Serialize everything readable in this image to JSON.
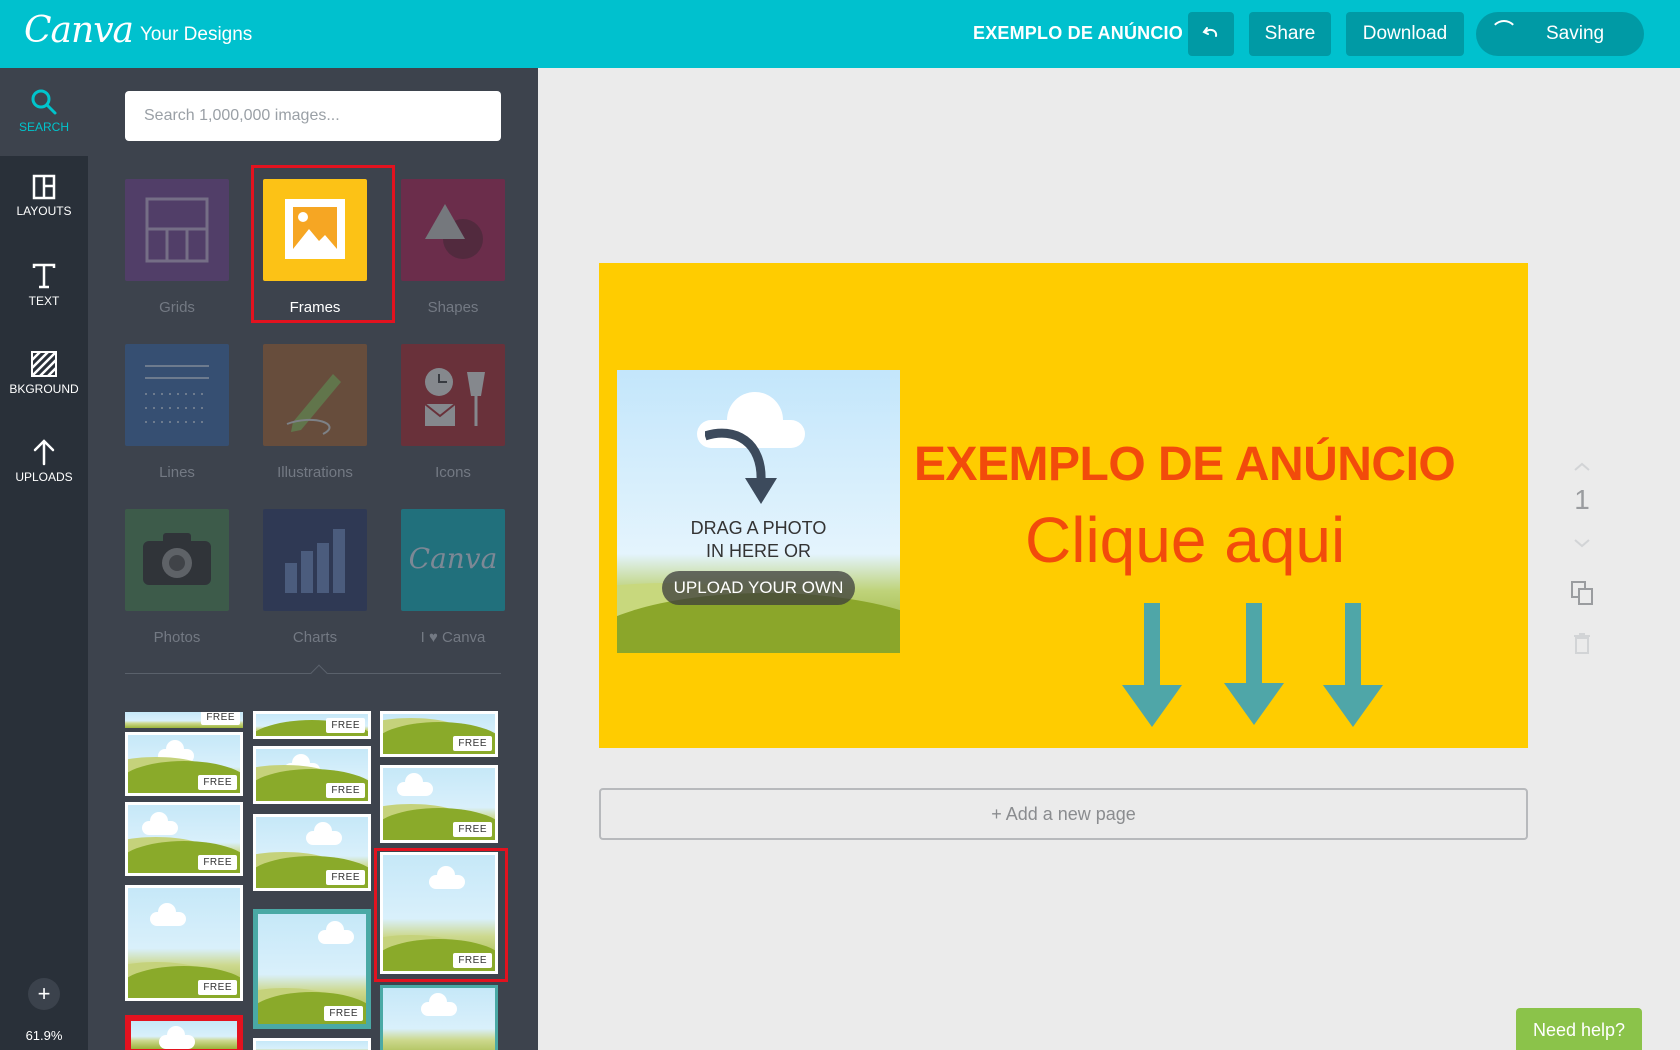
{
  "app": {
    "logo_text": "Canva"
  },
  "header": {
    "your_designs": "Your Designs",
    "doc_title": "EXEMPLO DE ANÚNCIO",
    "share_label": "Share",
    "download_label": "Download",
    "saving_label": "Saving"
  },
  "rail": {
    "items": [
      {
        "label": "SEARCH",
        "icon": "search-icon"
      },
      {
        "label": "LAYOUTS",
        "icon": "layouts-icon"
      },
      {
        "label": "TEXT",
        "icon": "text-icon"
      },
      {
        "label": "BKGROUND",
        "icon": "background-icon"
      },
      {
        "label": "UPLOADS",
        "icon": "upload-icon"
      }
    ],
    "zoom_in": "+",
    "zoom_level": "61.9%",
    "zoom_out": "–"
  },
  "panel": {
    "search_placeholder": "Search 1,000,000 images...",
    "categories": [
      "Grids",
      "Frames",
      "Shapes",
      "Lines",
      "Illustrations",
      "Icons",
      "Photos",
      "Charts",
      "I ♥ Canva"
    ],
    "badge": "FREE"
  },
  "design": {
    "drag_line1": "DRAG A PHOTO",
    "drag_line2": "IN HERE OR",
    "upload_label": "UPLOAD YOUR OWN",
    "headline": "EXEMPLO DE ANÚNCIO",
    "subline": "Clique aqui",
    "bg_color": "#ffcc00",
    "text_color": "#f24b0b",
    "arrow_color": "#4fa6a8"
  },
  "canvas": {
    "add_page": "+ Add a new page",
    "page_number": "1"
  },
  "help": {
    "label": "Need help?"
  },
  "colors": {
    "accent": "#00c1ce",
    "panel": "#3d434d",
    "rail": "#293039",
    "highlight": "#e3121f"
  }
}
